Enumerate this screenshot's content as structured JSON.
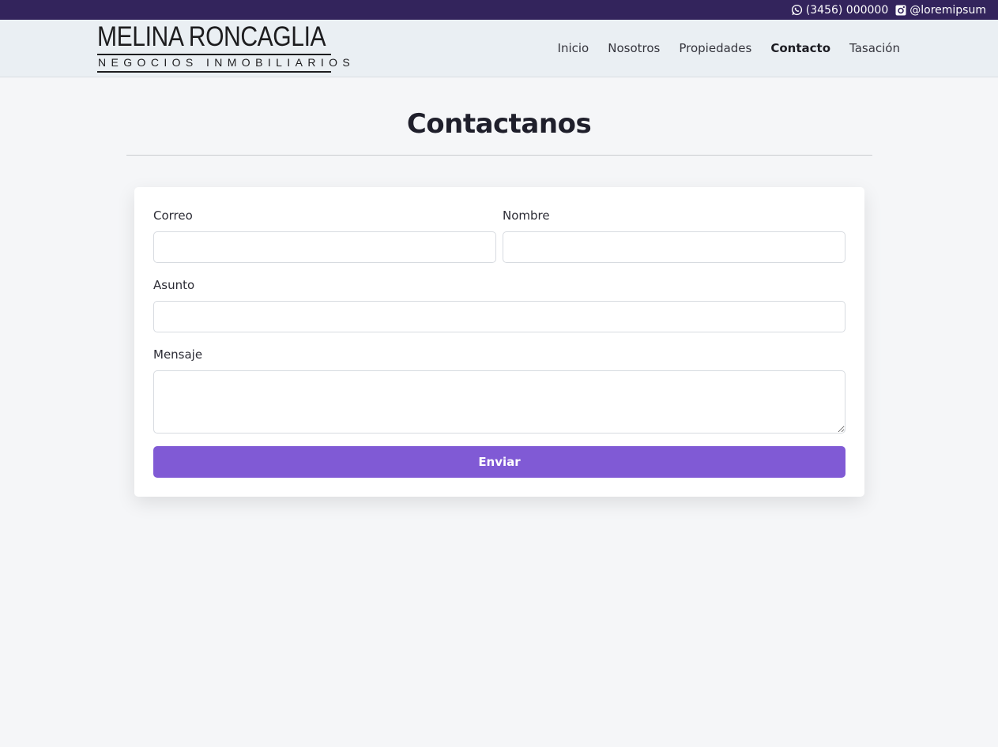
{
  "topbar": {
    "phone": "(3456) 000000",
    "phone_icon": "whatsapp-icon",
    "instagram": "@loremipsum",
    "instagram_icon": "instagram-icon"
  },
  "brand": {
    "name": "MELINA RONCAGLIA",
    "tagline": "NEGOCIOS INMOBILIARIOS"
  },
  "nav": {
    "items": [
      {
        "label": "Inicio"
      },
      {
        "label": "Nosotros"
      },
      {
        "label": "Propiedades"
      },
      {
        "label": "Contacto",
        "active": true
      },
      {
        "label": "Tasación"
      }
    ]
  },
  "main": {
    "title": "Contactanos"
  },
  "form": {
    "email_label": "Correo",
    "email_value": "",
    "name_label": "Nombre",
    "name_value": "",
    "subject_label": "Asunto",
    "subject_value": "",
    "message_label": "Mensaje",
    "message_value": "",
    "submit_label": "Enviar"
  },
  "colors": {
    "topbar_bg": "#33245c",
    "header_bg": "#eaeff3",
    "page_bg": "#f5f6f8",
    "accent": "#805ad5"
  }
}
